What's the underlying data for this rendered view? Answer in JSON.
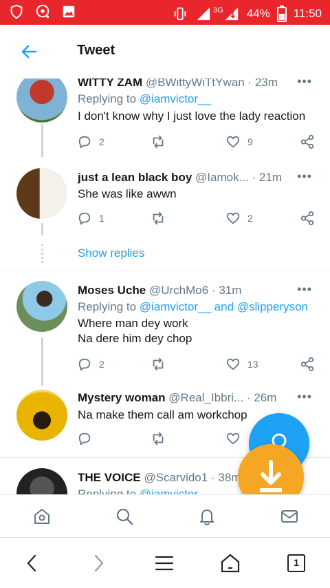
{
  "status_bar": {
    "network": "3G",
    "battery": "44%",
    "time": "11:50"
  },
  "header": {
    "title": "Tweet"
  },
  "tweets": [
    {
      "name": "WITTY ZAM",
      "handle": "@BWittyWiTtYwan",
      "time": "23m",
      "replying_prefix": "Replying to ",
      "replying_to": "@iamvictor__",
      "lines": [
        "I don't know why I just love the lady reaction"
      ],
      "replies": "2",
      "retweets": "",
      "likes": "9"
    },
    {
      "name": "just a lean black boy",
      "handle": "@Iamok...",
      "time": "21m",
      "lines": [
        "She was like awwn"
      ],
      "replies": "1",
      "retweets": "",
      "likes": "2"
    },
    {
      "name": "Moses Uche",
      "handle": "@UrchMo6",
      "time": "31m",
      "replying_prefix": "Replying to ",
      "replying_to": "@iamvictor__ and @slipperyson",
      "lines": [
        "Where man dey work",
        "Na dere him dey chop"
      ],
      "replies": "2",
      "retweets": "",
      "likes": "13"
    },
    {
      "name": "Mystery woman",
      "handle": "@Real_Ibbri...",
      "time": "26m",
      "lines": [
        "Na make them call am workchop"
      ],
      "replies": "",
      "retweets": "",
      "likes": ""
    },
    {
      "name": "THE VOICE",
      "handle": "@Scarvido1",
      "time": "38m",
      "replying_prefix": "Replying to ",
      "replying_to": "@iamvictor"
    }
  ],
  "show_replies": "Show replies",
  "separator": "·",
  "more": "•••",
  "tab_counter": "1",
  "colors": {
    "status_bar": "#e8262b",
    "accent": "#1da1f2",
    "download_fab": "#f5a623"
  }
}
